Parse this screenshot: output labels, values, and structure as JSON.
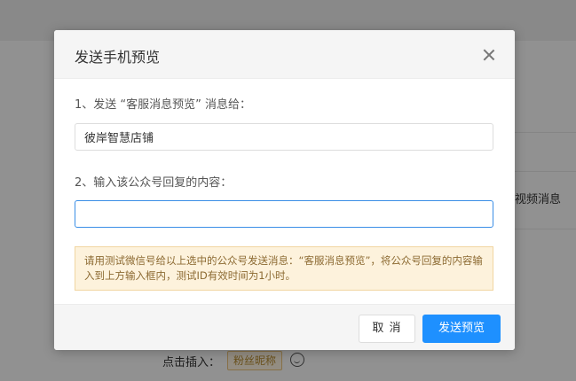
{
  "background": {
    "side_text": "视频消息",
    "insert_label": "点击插入：",
    "insert_tag": "粉丝昵称"
  },
  "dialog": {
    "title": "发送手机预览",
    "step1_label": "1、发送 “客服消息预览” 消息给：",
    "account_value": "彼岸智慧店铺",
    "step2_label": "2、输入该公众号回复的内容：",
    "reply_value": "",
    "reply_placeholder": "",
    "notice": "请用测试微信号给以上选中的公众号发送消息：“客服消息预览”，将公众号回复的内容输入到上方输入框内，测试ID有效时间为1小时。",
    "cancel_label": "取 消",
    "send_label": "发送预览"
  },
  "colors": {
    "primary": "#1e90ff",
    "notice_bg": "#fdf2dc",
    "notice_text": "#8c6a32"
  }
}
